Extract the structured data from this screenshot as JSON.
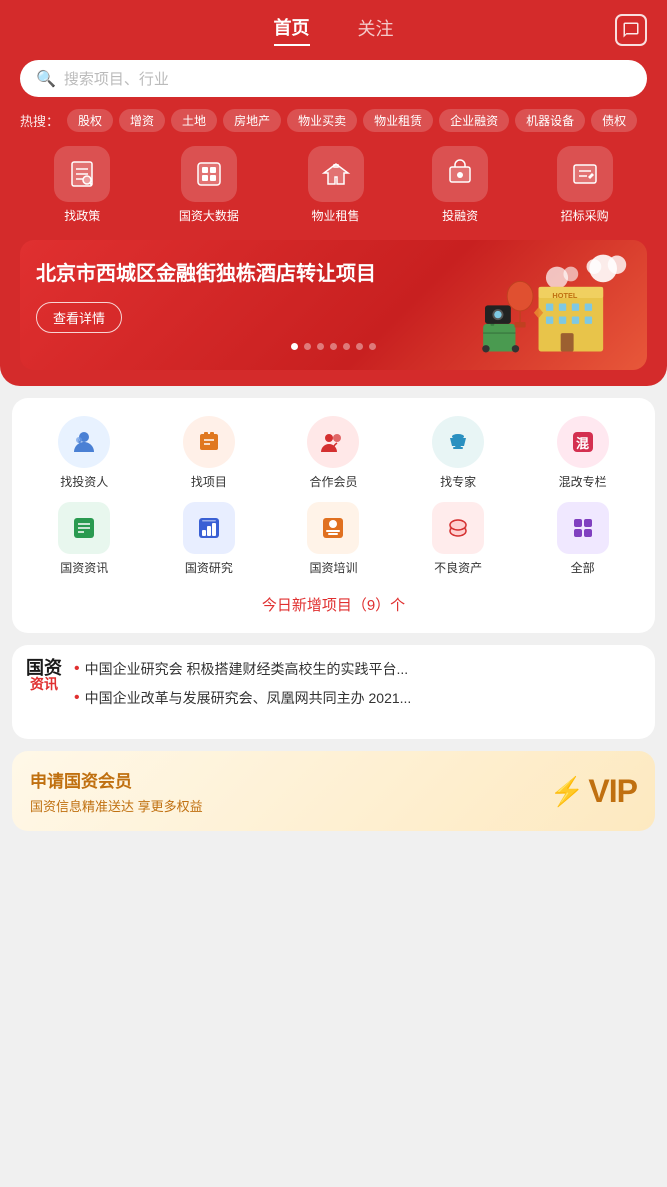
{
  "header": {
    "nav": [
      {
        "id": "home",
        "label": "首页",
        "active": true
      },
      {
        "id": "follow",
        "label": "关注",
        "active": false
      }
    ],
    "msg_icon": "message-icon"
  },
  "search": {
    "placeholder": "搜索项目、行业"
  },
  "hot_search": {
    "label": "热搜：",
    "tags": [
      "股权",
      "增资",
      "土地",
      "房地产",
      "物业买卖",
      "物业租赁",
      "企业融资",
      "机器设备",
      "债权"
    ]
  },
  "icon_menu": [
    {
      "id": "find-policy",
      "label": "找政策",
      "icon": "📋"
    },
    {
      "id": "state-asset-data",
      "label": "国资大数据",
      "icon": "🏠"
    },
    {
      "id": "property-rent",
      "label": "物业租售",
      "icon": "🏠"
    },
    {
      "id": "investment",
      "label": "投融资",
      "icon": "🏛"
    },
    {
      "id": "procurement",
      "label": "招标采购",
      "icon": "📦"
    }
  ],
  "banner": {
    "title": "北京市西城区金融街独栋酒店转让项目",
    "button": "查看详情",
    "dots": 7,
    "active_dot": 0
  },
  "grid_icons": [
    {
      "id": "find-investor",
      "label": "找投资人",
      "icon": "👤",
      "color": "ic-blue"
    },
    {
      "id": "find-project",
      "label": "找项目",
      "icon": "📁",
      "color": "ic-orange"
    },
    {
      "id": "coop-member",
      "label": "合作会员",
      "icon": "👥",
      "color": "ic-red"
    },
    {
      "id": "find-expert",
      "label": "找专家",
      "icon": "🎓",
      "color": "ic-teal"
    },
    {
      "id": "mixed-reform",
      "label": "混改专栏",
      "icon": "🏷",
      "color": "ic-pink"
    }
  ],
  "row2_icons": [
    {
      "id": "state-news",
      "label": "国资资讯",
      "icon": "📰",
      "color": "ir-green"
    },
    {
      "id": "state-research",
      "label": "国资研究",
      "icon": "📊",
      "color": "ir-blue2"
    },
    {
      "id": "state-training",
      "label": "国资培训",
      "icon": "👩‍💼",
      "color": "ir-orange2"
    },
    {
      "id": "bad-asset",
      "label": "不良资产",
      "icon": "💾",
      "color": "ir-red2"
    },
    {
      "id": "all",
      "label": "全部",
      "icon": "⚙",
      "color": "ir-purple"
    }
  ],
  "today_new": {
    "text": "今日新增项目（9）个"
  },
  "news": {
    "badge_top": "国资",
    "badge_bot": "资讯",
    "items": [
      "中国企业研究会 积极搭建财经类高校生的实践平台...",
      "中国企业改革与发展研究会、凤凰网共同主办 2021..."
    ]
  },
  "vip": {
    "title": "申请国资会员",
    "subtitle": "国资信息精准送达 享更多权益",
    "badge": "VIP"
  }
}
